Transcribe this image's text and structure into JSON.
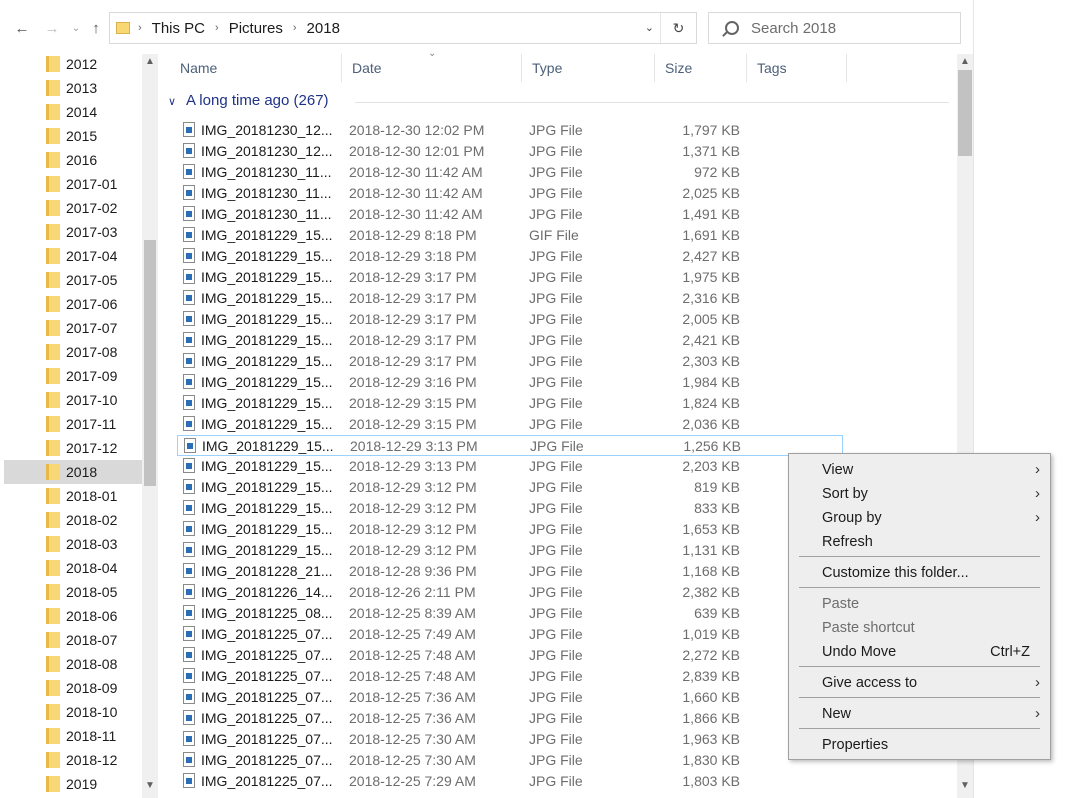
{
  "address": {
    "crumbs": [
      "This PC",
      "Pictures",
      "2018"
    ],
    "search_placeholder": "Search 2018"
  },
  "nav": {
    "items": [
      "2012",
      "2013",
      "2014",
      "2015",
      "2016",
      "2017-01",
      "2017-02",
      "2017-03",
      "2017-04",
      "2017-05",
      "2017-06",
      "2017-07",
      "2017-08",
      "2017-09",
      "2017-10",
      "2017-11",
      "2017-12",
      "2018",
      "2018-01",
      "2018-02",
      "2018-03",
      "2018-04",
      "2018-05",
      "2018-06",
      "2018-07",
      "2018-08",
      "2018-09",
      "2018-10",
      "2018-11",
      "2018-12",
      "2019"
    ],
    "selected": "2018"
  },
  "columns": {
    "name": "Name",
    "date": "Date",
    "type": "Type",
    "size": "Size",
    "tags": "Tags"
  },
  "group": {
    "label": "A long time ago (267)"
  },
  "files": [
    {
      "name": "IMG_20181230_12...",
      "date": "2018-12-30 12:02 PM",
      "type": "JPG File",
      "size": "1,797 KB"
    },
    {
      "name": "IMG_20181230_12...",
      "date": "2018-12-30 12:01 PM",
      "type": "JPG File",
      "size": "1,371 KB"
    },
    {
      "name": "IMG_20181230_11...",
      "date": "2018-12-30 11:42 AM",
      "type": "JPG File",
      "size": "972 KB"
    },
    {
      "name": "IMG_20181230_11...",
      "date": "2018-12-30 11:42 AM",
      "type": "JPG File",
      "size": "2,025 KB"
    },
    {
      "name": "IMG_20181230_11...",
      "date": "2018-12-30 11:42 AM",
      "type": "JPG File",
      "size": "1,491 KB"
    },
    {
      "name": "IMG_20181229_15...",
      "date": "2018-12-29 8:18 PM",
      "type": "GIF File",
      "size": "1,691 KB"
    },
    {
      "name": "IMG_20181229_15...",
      "date": "2018-12-29 3:18 PM",
      "type": "JPG File",
      "size": "2,427 KB"
    },
    {
      "name": "IMG_20181229_15...",
      "date": "2018-12-29 3:17 PM",
      "type": "JPG File",
      "size": "1,975 KB"
    },
    {
      "name": "IMG_20181229_15...",
      "date": "2018-12-29 3:17 PM",
      "type": "JPG File",
      "size": "2,316 KB"
    },
    {
      "name": "IMG_20181229_15...",
      "date": "2018-12-29 3:17 PM",
      "type": "JPG File",
      "size": "2,005 KB"
    },
    {
      "name": "IMG_20181229_15...",
      "date": "2018-12-29 3:17 PM",
      "type": "JPG File",
      "size": "2,421 KB"
    },
    {
      "name": "IMG_20181229_15...",
      "date": "2018-12-29 3:17 PM",
      "type": "JPG File",
      "size": "2,303 KB"
    },
    {
      "name": "IMG_20181229_15...",
      "date": "2018-12-29 3:16 PM",
      "type": "JPG File",
      "size": "1,984 KB"
    },
    {
      "name": "IMG_20181229_15...",
      "date": "2018-12-29 3:15 PM",
      "type": "JPG File",
      "size": "1,824 KB"
    },
    {
      "name": "IMG_20181229_15...",
      "date": "2018-12-29 3:15 PM",
      "type": "JPG File",
      "size": "2,036 KB"
    },
    {
      "name": "IMG_20181229_15...",
      "date": "2018-12-29 3:13 PM",
      "type": "JPG File",
      "size": "1,256 KB"
    },
    {
      "name": "IMG_20181229_15...",
      "date": "2018-12-29 3:13 PM",
      "type": "JPG File",
      "size": "2,203 KB"
    },
    {
      "name": "IMG_20181229_15...",
      "date": "2018-12-29 3:12 PM",
      "type": "JPG File",
      "size": "819 KB"
    },
    {
      "name": "IMG_20181229_15...",
      "date": "2018-12-29 3:12 PM",
      "type": "JPG File",
      "size": "833 KB"
    },
    {
      "name": "IMG_20181229_15...",
      "date": "2018-12-29 3:12 PM",
      "type": "JPG File",
      "size": "1,653 KB"
    },
    {
      "name": "IMG_20181229_15...",
      "date": "2018-12-29 3:12 PM",
      "type": "JPG File",
      "size": "1,131 KB"
    },
    {
      "name": "IMG_20181228_21...",
      "date": "2018-12-28 9:36 PM",
      "type": "JPG File",
      "size": "1,168 KB"
    },
    {
      "name": "IMG_20181226_14...",
      "date": "2018-12-26 2:11 PM",
      "type": "JPG File",
      "size": "2,382 KB"
    },
    {
      "name": "IMG_20181225_08...",
      "date": "2018-12-25 8:39 AM",
      "type": "JPG File",
      "size": "639 KB"
    },
    {
      "name": "IMG_20181225_07...",
      "date": "2018-12-25 7:49 AM",
      "type": "JPG File",
      "size": "1,019 KB"
    },
    {
      "name": "IMG_20181225_07...",
      "date": "2018-12-25 7:48 AM",
      "type": "JPG File",
      "size": "2,272 KB"
    },
    {
      "name": "IMG_20181225_07...",
      "date": "2018-12-25 7:48 AM",
      "type": "JPG File",
      "size": "2,839 KB"
    },
    {
      "name": "IMG_20181225_07...",
      "date": "2018-12-25 7:36 AM",
      "type": "JPG File",
      "size": "1,660 KB"
    },
    {
      "name": "IMG_20181225_07...",
      "date": "2018-12-25 7:36 AM",
      "type": "JPG File",
      "size": "1,866 KB"
    },
    {
      "name": "IMG_20181225_07...",
      "date": "2018-12-25 7:30 AM",
      "type": "JPG File",
      "size": "1,963 KB"
    },
    {
      "name": "IMG_20181225_07...",
      "date": "2018-12-25 7:30 AM",
      "type": "JPG File",
      "size": "1,830 KB"
    },
    {
      "name": "IMG_20181225_07...",
      "date": "2018-12-25 7:29 AM",
      "type": "JPG File",
      "size": "1,803 KB"
    }
  ],
  "focused_file_index": 15,
  "context_menu": {
    "view": "View",
    "sort_by": "Sort by",
    "group_by": "Group by",
    "refresh": "Refresh",
    "customize": "Customize this folder...",
    "paste": "Paste",
    "paste_shortcut": "Paste shortcut",
    "undo_move": "Undo Move",
    "undo_move_shortcut": "Ctrl+Z",
    "give_access": "Give access to",
    "new": "New",
    "properties": "Properties"
  }
}
